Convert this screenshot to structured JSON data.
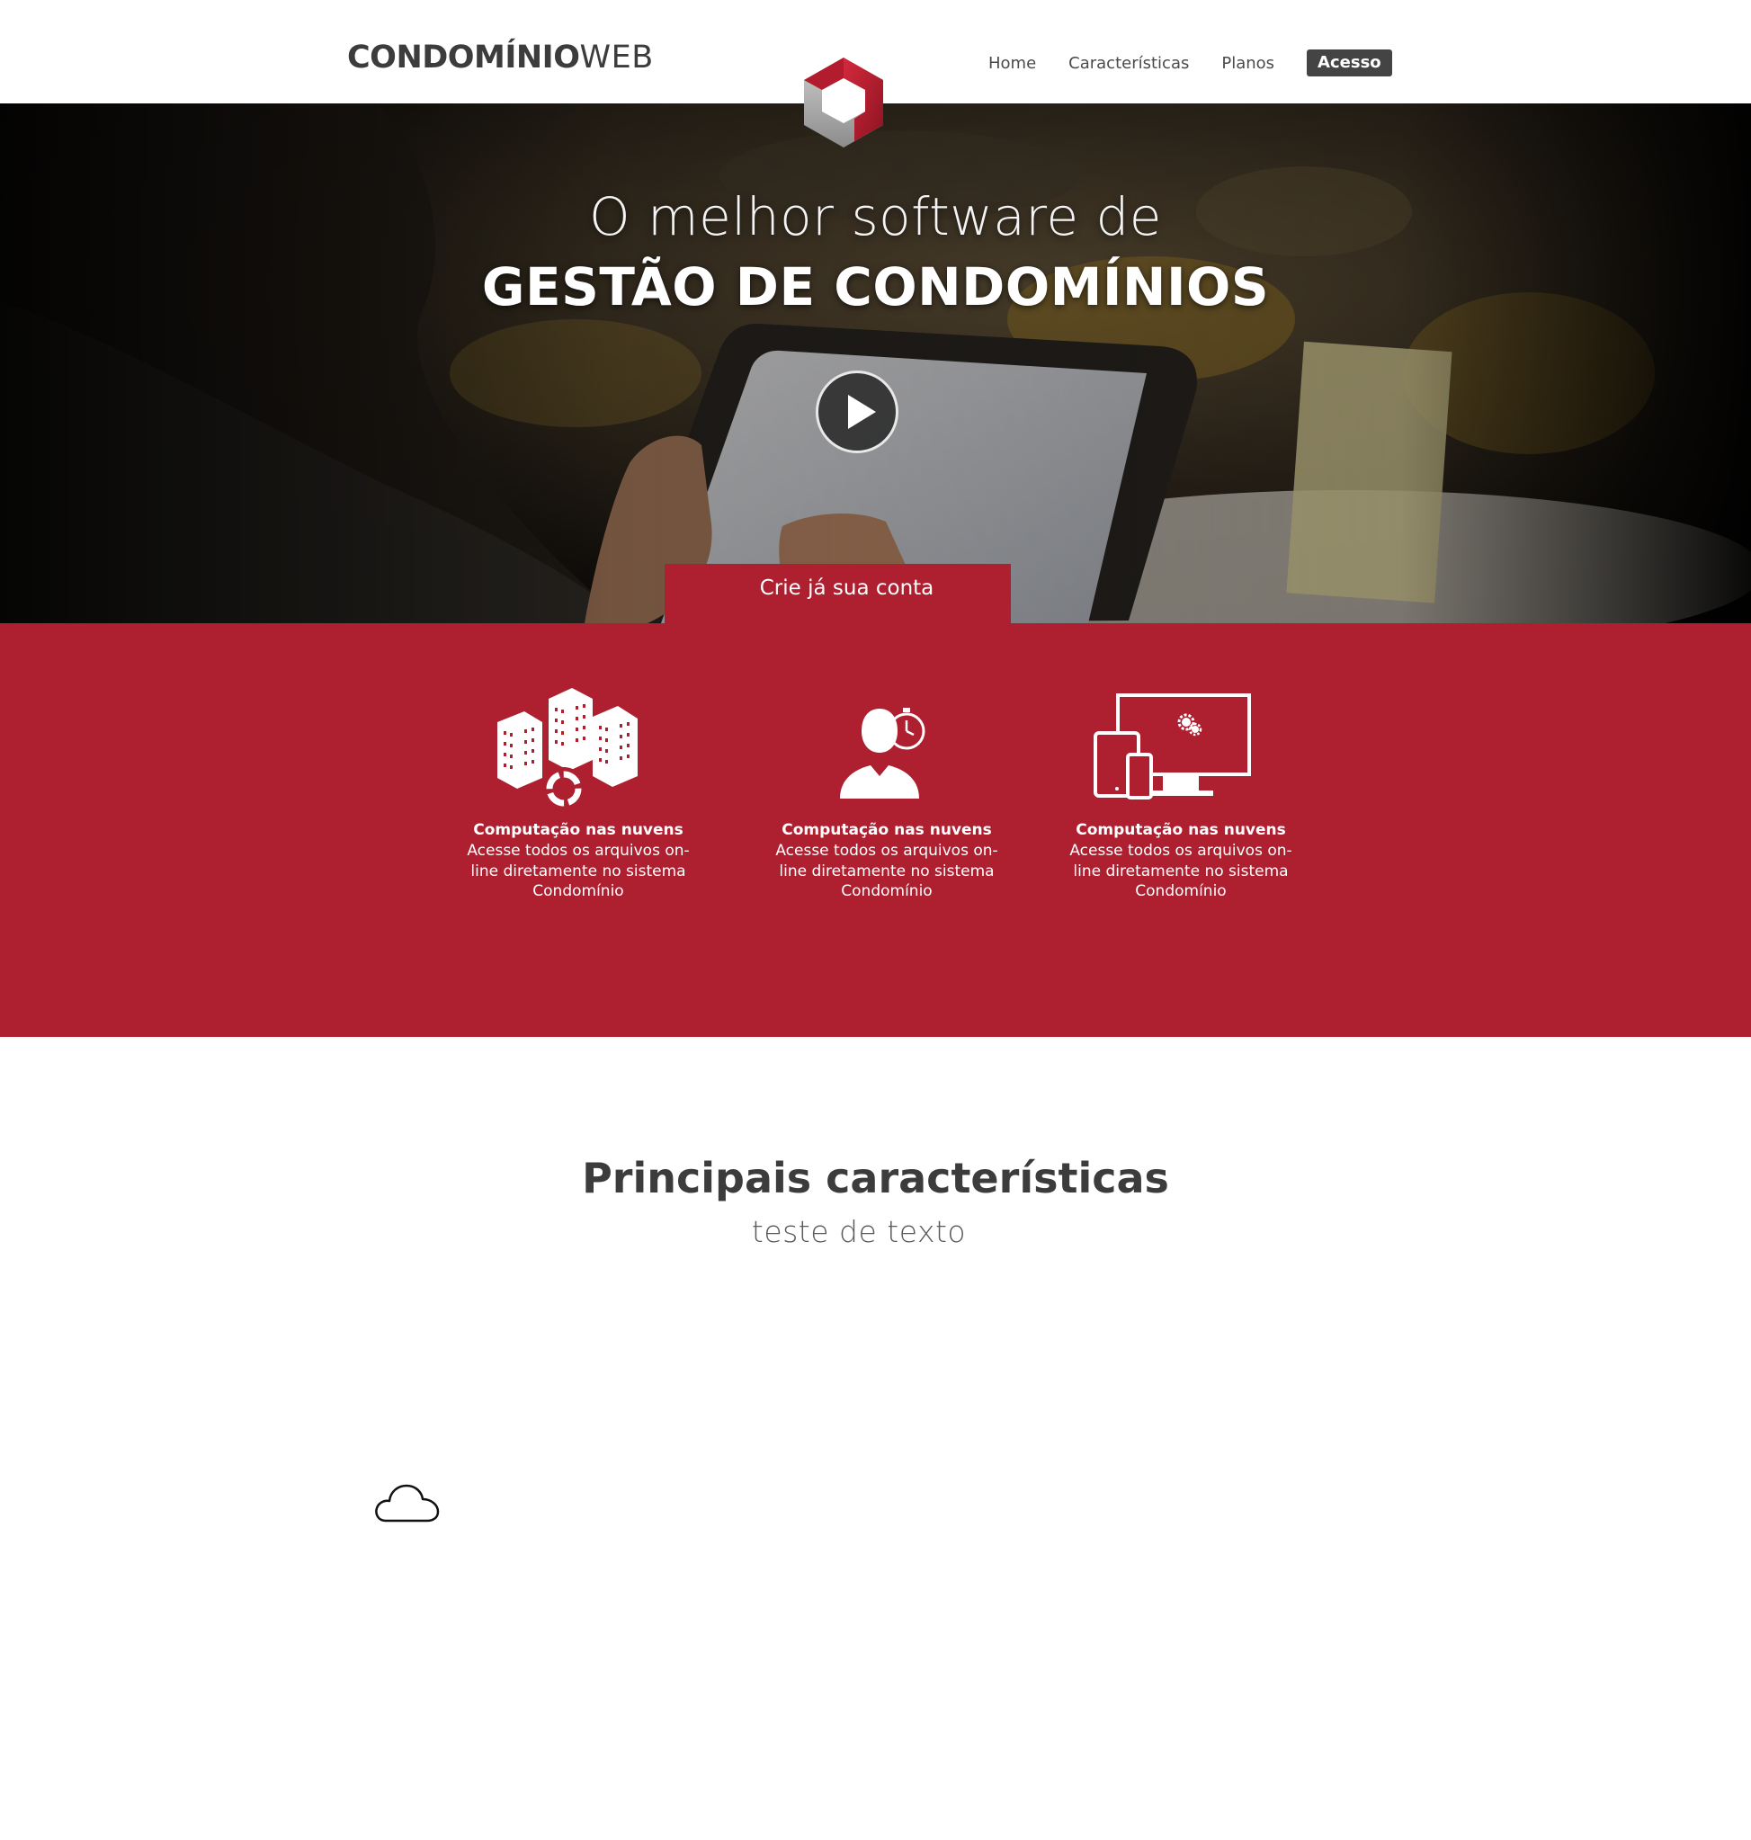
{
  "header": {
    "logo_bold": "CONDOMÍNIO",
    "logo_light": "WEB",
    "nav": [
      {
        "label": "Home"
      },
      {
        "label": "Características"
      },
      {
        "label": "Planos"
      }
    ],
    "access_label": "Acesso"
  },
  "hero": {
    "title_line1": "O melhor software de",
    "title_line2": "GESTÃO DE CONDOMÍNIOS",
    "cta_label": "Crie já sua conta"
  },
  "features": [
    {
      "icon": "buildings-sync-icon",
      "title": "Computação nas nuvens",
      "desc": "Acesse todos os arquivos on-line diretamente no sistema Condomínio"
    },
    {
      "icon": "user-clock-icon",
      "title": "Computação nas nuvens",
      "desc": "Acesse todos os arquivos on-line diretamente no sistema Condomínio"
    },
    {
      "icon": "devices-gear-icon",
      "title": "Computação nas nuvens",
      "desc": "Acesse todos os arquivos on-line diretamente no sistema Condomínio"
    }
  ],
  "section": {
    "title": "Principais características",
    "subtitle": "teste de texto",
    "icon": "cloud-icon"
  },
  "colors": {
    "brand_red": "#ae1f30",
    "dark": "#3c3c3c",
    "button_dark": "#444444"
  }
}
